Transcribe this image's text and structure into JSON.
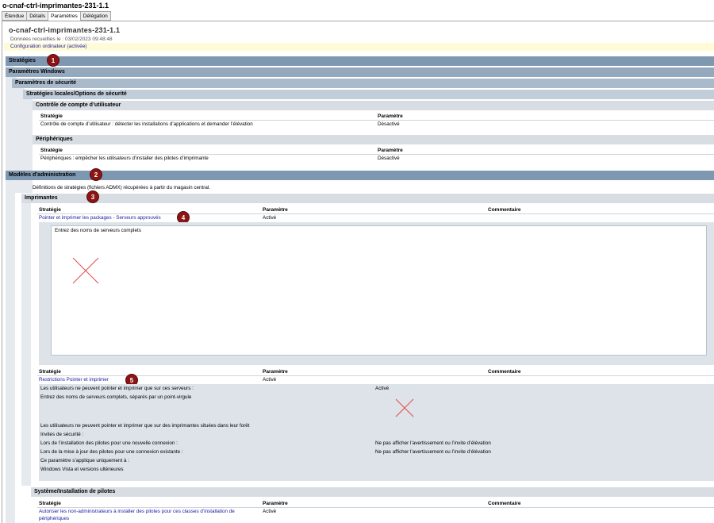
{
  "window": {
    "title": "o-cnaf-ctrl-imprimantes-231-1.1"
  },
  "tabs": [
    "Étendue",
    "Détails",
    "Paramètres",
    "Délégation"
  ],
  "header": {
    "title": "o-cnaf-ctrl-imprimantes-231-1.1",
    "collected": "Données recueillies le : 03/02/2023 09:48:48",
    "config": "Configuration ordinateur (activée)"
  },
  "sections": {
    "strategies": "Stratégies",
    "windows": "Paramètres Windows",
    "security": "Paramètres de sécurité",
    "local": "Stratégies locales/Options de sécurité",
    "uac": "Contrôle de compte d’utilisateur",
    "peripherals": "Périphériques",
    "admin": "Modèles d’administration",
    "admin_desc": "Définitions de stratégies (fichiers ADMX) récupérées à partir du magasin central.",
    "printers": "Imprimantes",
    "driver_install": "Système/Installation de pilotes"
  },
  "columns": {
    "strategy": "Stratégie",
    "setting": "Paramètre",
    "comment": "Commentaire"
  },
  "uac_row": {
    "name": "Contrôle de compte d’utilisateur : détecter les installations d’applications et demander l’élévation",
    "value": "Désactivé"
  },
  "periph_row": {
    "name": "Périphériques : empêcher les utilisateurs d’installer des pilotes d’imprimante",
    "value": "Désactivé"
  },
  "printer_row1": {
    "name": "Pointer et imprimer les packages - Serveurs approuvés",
    "value": "Activé",
    "box_label": "Entrez des noms de serveurs complets"
  },
  "printer_row2": {
    "name": "Restrictions Pointer et imprimer",
    "value": "Activé",
    "details": [
      {
        "label": "Les utilisateurs ne peuvent pointer et imprimer que sur ces serveurs :",
        "value": "Activé"
      },
      {
        "label": "Entrez des noms de serveurs complets, séparés par un point-virgule",
        "value": ""
      },
      {
        "label": "Les utilisateurs ne peuvent pointer et imprimer que sur des imprimantes situées dans leur forêt",
        "value": ""
      },
      {
        "label": "Invites de sécurité :",
        "value": ""
      },
      {
        "label": "Lors de l’installation des pilotes pour une nouvelle connexion :",
        "value": "Ne pas afficher l’avertissement ou l’invite d’élévation"
      },
      {
        "label": "Lors de la mise à jour des pilotes pour une connexion existante :",
        "value": "Ne pas afficher l’avertissement ou l’invite d’élévation"
      },
      {
        "label": "Ce paramètre s’applique uniquement à :",
        "value": ""
      },
      {
        "label": "Windows Vista et versions ultérieures",
        "value": ""
      }
    ]
  },
  "driver_row": {
    "name_line1": "Autoriser les non-administrateurs à installer des pilotes pour ces classes d’installation de",
    "name_line2": "périphériques",
    "value": "Activé"
  },
  "badges": [
    "1",
    "2",
    "3",
    "4",
    "5"
  ],
  "colors": {
    "accent_link": "#1a1aa6",
    "badge": "#8b1414",
    "band": "#7f98b2",
    "missing_image": "#e34b4b"
  },
  "icons": [
    "missing-image-icon"
  ]
}
